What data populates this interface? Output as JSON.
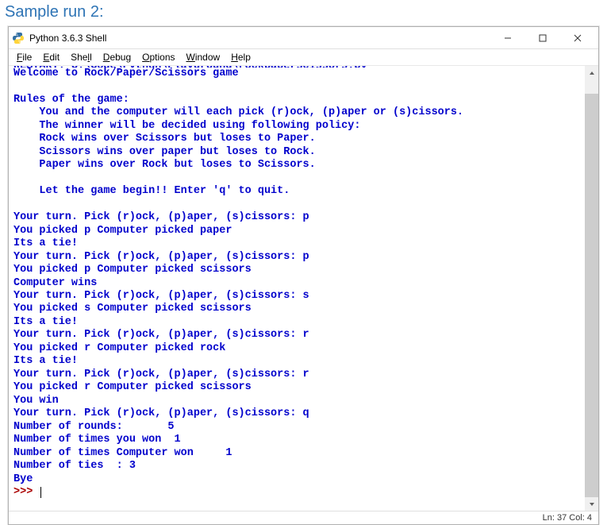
{
  "heading": "Sample run 2:",
  "window": {
    "title": "Python 3.6.3 Shell"
  },
  "menu": {
    "file": "File",
    "edit": "Edit",
    "shell": "Shell",
    "debug": "Debug",
    "options": "Options",
    "window": "Window",
    "help": "Help"
  },
  "console": {
    "partial_top": "RESTART: C:\\Code\\Python\\Playground\\rockpaperscissors.py",
    "lines": [
      "Welcome to Rock/Paper/Scissors game",
      "",
      "Rules of the game:",
      "    You and the computer will each pick (r)ock, (p)aper or (s)cissors.",
      "    The winner will be decided using following policy:",
      "    Rock wins over Scissors but loses to Paper.",
      "    Scissors wins over paper but loses to Rock.",
      "    Paper wins over Rock but loses to Scissors.",
      "",
      "    Let the game begin!! Enter 'q' to quit.",
      "",
      "Your turn. Pick (r)ock, (p)aper, (s)cissors: p",
      "You picked p Computer picked paper",
      "Its a tie!",
      "Your turn. Pick (r)ock, (p)aper, (s)cissors: p",
      "You picked p Computer picked scissors",
      "Computer wins",
      "Your turn. Pick (r)ock, (p)aper, (s)cissors: s",
      "You picked s Computer picked scissors",
      "Its a tie!",
      "Your turn. Pick (r)ock, (p)aper, (s)cissors: r",
      "You picked r Computer picked rock",
      "Its a tie!",
      "Your turn. Pick (r)ock, (p)aper, (s)cissors: r",
      "You picked r Computer picked scissors",
      "You win",
      "Your turn. Pick (r)ock, (p)aper, (s)cissors: q",
      "Number of rounds:       5",
      "Number of times you won  1",
      "Number of times Computer won     1",
      "Number of ties  : 3",
      "Bye"
    ],
    "prompt": ">>> "
  },
  "status": {
    "text": "Ln: 37  Col: 4"
  }
}
